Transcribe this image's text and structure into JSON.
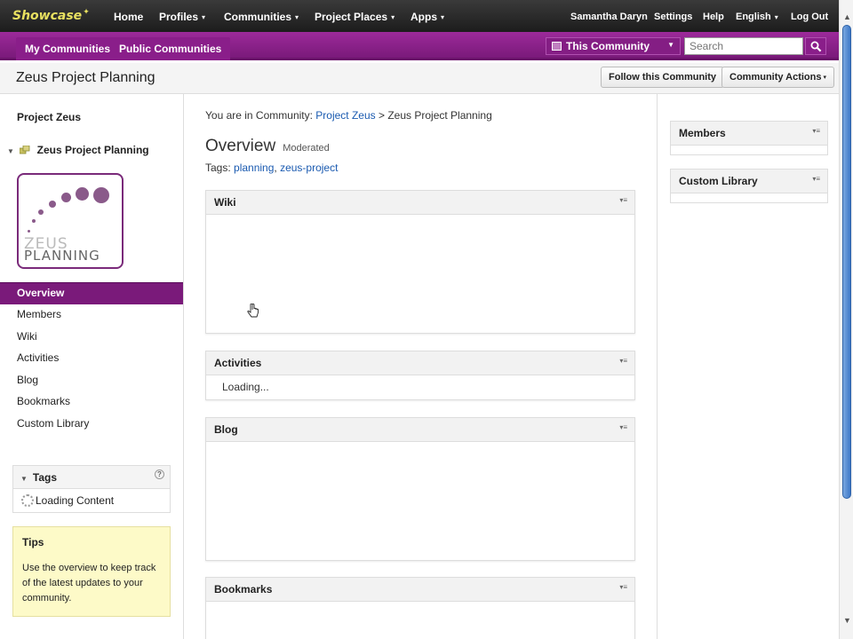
{
  "top_nav": {
    "logo": "Showcase",
    "items": [
      {
        "label": "Home",
        "caret": ""
      },
      {
        "label": "Profiles",
        "caret": "▾"
      },
      {
        "label": "Communities",
        "caret": "▾"
      },
      {
        "label": "Project Places",
        "caret": "▾"
      },
      {
        "label": "Apps",
        "caret": "▾"
      }
    ],
    "user": "Samantha Daryn",
    "settings": "Settings",
    "help": "Help",
    "language": "English",
    "logout": "Log Out"
  },
  "sub_nav": {
    "my_communities": "My Communities",
    "public_communities": "Public Communities",
    "search_scope": "This Community",
    "search_placeholder": "Search"
  },
  "title_bar": {
    "title": "Zeus Project Planning",
    "follow_button": "Follow this Community",
    "actions_button": "Community Actions"
  },
  "left": {
    "parent": "Project Zeus",
    "current": "Zeus Project Planning",
    "logo_text_top": "ZEUS",
    "logo_text_bottom": "PLANNING",
    "nav": [
      {
        "label": "Overview",
        "active": true
      },
      {
        "label": "Members",
        "active": false
      },
      {
        "label": "Wiki",
        "active": false
      },
      {
        "label": "Activities",
        "active": false
      },
      {
        "label": "Blog",
        "active": false
      },
      {
        "label": "Bookmarks",
        "active": false
      },
      {
        "label": "Custom Library",
        "active": false
      }
    ],
    "tags_widget": {
      "title": "Tags",
      "help": "?",
      "loading": "Loading Content"
    },
    "tips": {
      "title": "Tips",
      "text": "Use the overview to keep track of the latest updates to your community."
    }
  },
  "center": {
    "breadcrumb": {
      "prefix": "You are in Community: ",
      "parent": "Project Zeus",
      "separator": " > ",
      "current": "Zeus Project Planning"
    },
    "heading": "Overview",
    "moderated": "Moderated",
    "tags_prefix": "Tags: ",
    "tags": [
      "planning",
      "zeus-project"
    ],
    "widgets": [
      {
        "title": "Wiki",
        "body": ""
      },
      {
        "title": "Activities",
        "body": "Loading..."
      },
      {
        "title": "Blog",
        "body": ""
      },
      {
        "title": "Bookmarks",
        "body": ""
      }
    ]
  },
  "right": {
    "widgets": [
      {
        "title": "Members"
      },
      {
        "title": "Custom Library"
      }
    ]
  },
  "colors": {
    "nav_dark": "#2a2a2a",
    "brand_purple": "#7a1a7a",
    "link_blue": "#1a5ab0",
    "tips_yellow": "#fdfac8"
  }
}
